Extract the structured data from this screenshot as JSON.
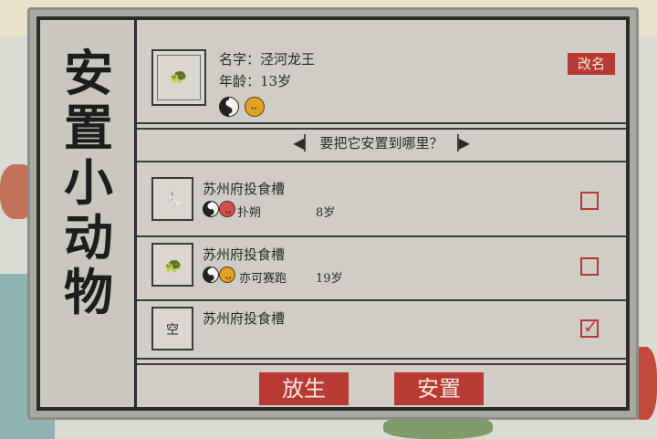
{
  "dialog": {
    "title": "安置小动物",
    "rename_label": "改名",
    "current": {
      "name_label": "名字：泾河龙王",
      "age_label": "年龄：13岁",
      "icon": "turtle-icon"
    },
    "prompt": "要把它安置到哪里？",
    "options": [
      {
        "place": "苏州府投食槽",
        "occupant": "扑朔",
        "age": "8岁",
        "icon": "rabbit-icon",
        "checked": false
      },
      {
        "place": "苏州府投食槽",
        "occupant": "亦可赛跑",
        "age": "19岁",
        "icon": "turtle-icon",
        "checked": false
      },
      {
        "place": "苏州府投食槽",
        "empty_label": "空",
        "checked": true
      }
    ],
    "release_label": "放生",
    "place_label": "安置"
  },
  "colors": {
    "accent": "#b83a33",
    "panel": "#cfcdc6",
    "ink": "#2c2b29"
  }
}
